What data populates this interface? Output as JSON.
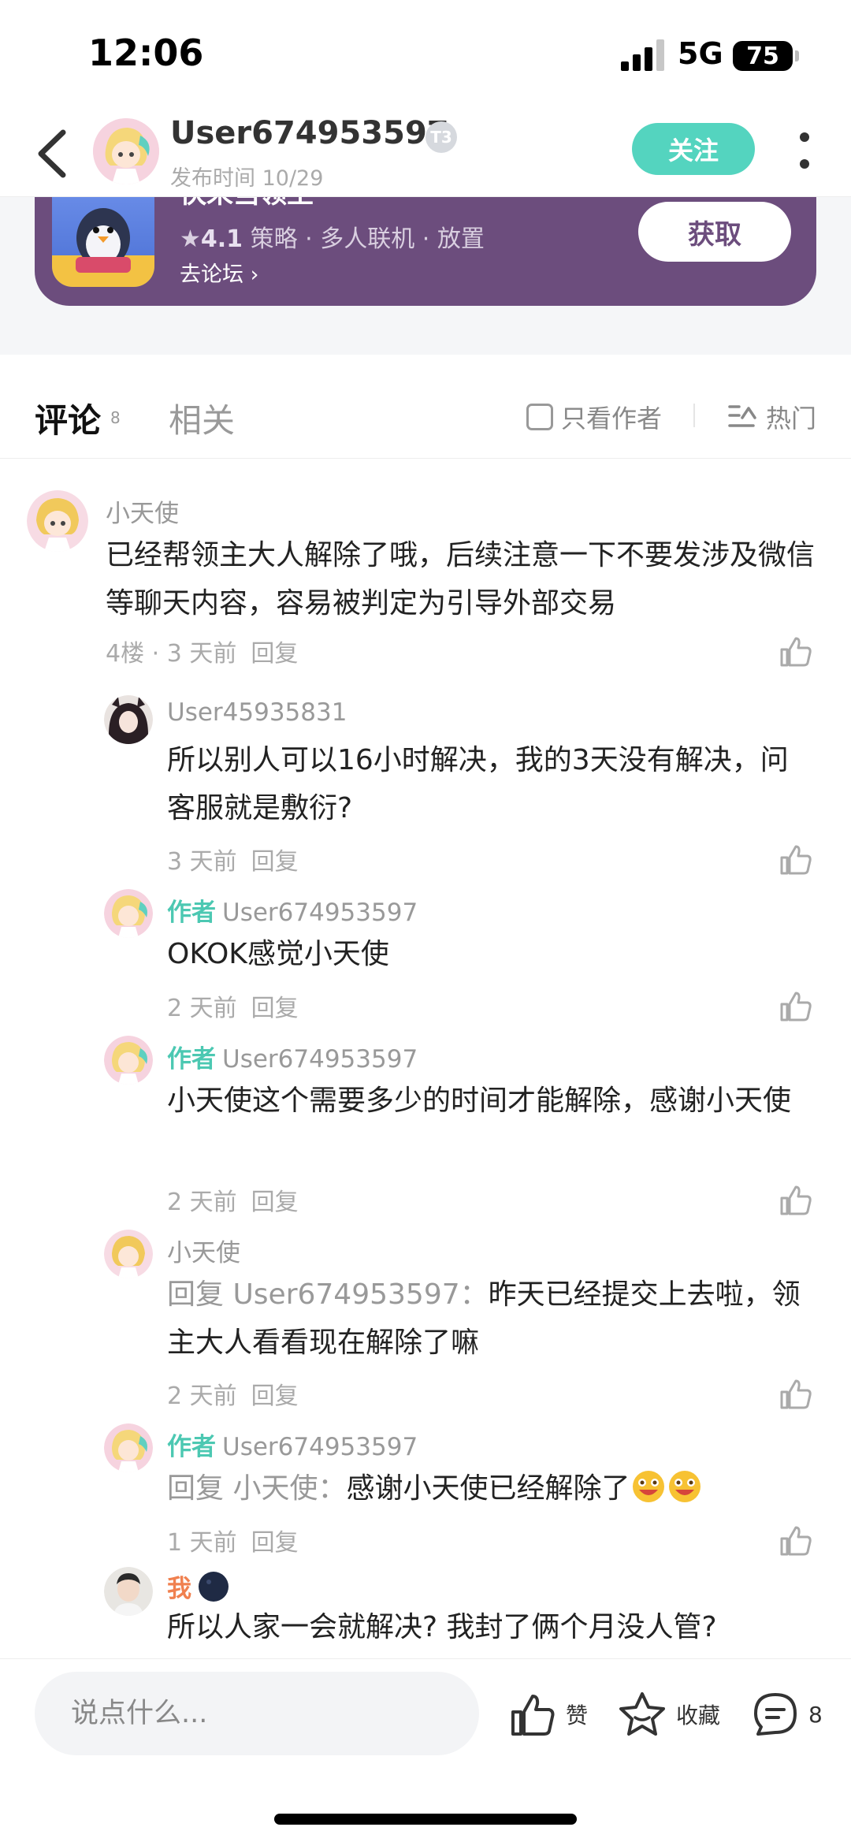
{
  "status_bar": {
    "time": "12:06",
    "network": "5G",
    "battery": "75"
  },
  "header": {
    "username": "User674953597",
    "badge": "T3",
    "post_time": "发布时间 10/29",
    "follow_label": "关注"
  },
  "game_card": {
    "title": "快来当领主",
    "rating": "4.1",
    "tags": "策略 · 多人联机 · 放置",
    "forum_link": "去论坛",
    "get_label": "获取"
  },
  "tabs": {
    "comments": "评论",
    "comments_count": "8",
    "related": "相关",
    "only_author": "只看作者",
    "sort": "热门"
  },
  "comments": [
    {
      "name": "小天使",
      "text": "已经帮领主大人解除了哦，后续注意一下不要发涉及微信等聊天内容，容易被判定为引导外部交易",
      "meta": "4楼 · 3 天前",
      "reply": "回复"
    },
    {
      "name": "User45935831",
      "text": "所以别人可以16小时解决，我的3天没有解决，问客服就是敷衍?",
      "meta": "3 天前",
      "reply": "回复"
    },
    {
      "tag": "作者",
      "name": "User674953597",
      "text": "OKOK感觉小天使",
      "meta": "2 天前",
      "reply": "回复"
    },
    {
      "tag": "作者",
      "name": "User674953597",
      "text": "小天使这个需要多少的时间才能解除，感谢小天使",
      "meta": "2 天前",
      "reply": "回复"
    },
    {
      "name": "小天使",
      "reply_prefix": "回复 User674953597：",
      "text": "昨天已经提交上去啦，领主大人看看现在解除了嘛",
      "meta": "2 天前",
      "reply": "回复"
    },
    {
      "tag": "作者",
      "name": "User674953597",
      "reply_prefix": "回复 小天使：",
      "text": "感谢小天使已经解除了",
      "meta": "1 天前",
      "reply": "回复"
    },
    {
      "tag": "我",
      "name": "",
      "text": "所以人家一会就解决? 我封了俩个月没人管?"
    }
  ],
  "bottom_bar": {
    "placeholder": "说点什么...",
    "like_label": "赞",
    "fav_label": "收藏",
    "comment_count": "8"
  },
  "colors": {
    "accent": "#54d4bf",
    "card_bg": "#6c4d7d",
    "author_tag": "#4cc8b2",
    "me_tag": "#f0804f"
  }
}
